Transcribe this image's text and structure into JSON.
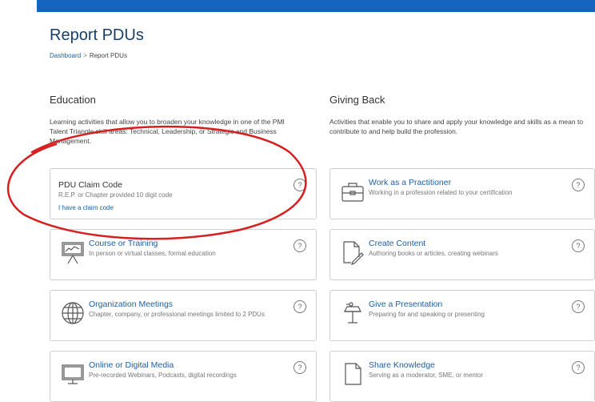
{
  "header": {
    "title": "Report PDUs"
  },
  "breadcrumb": {
    "home": "Dashboard",
    "sep": ">",
    "current": "Report PDUs"
  },
  "education": {
    "heading": "Education",
    "desc": "Learning activities that allow you to broaden your knowledge in one of the PMI Talent Triangle skill areas: Technical, Leadership, or Strategic and Business Management.",
    "claim": {
      "title": "PDU Claim Code",
      "desc": "R.E.P. or Chapter provided 10 digit code",
      "link": "I have a claim code",
      "help": "?"
    },
    "cards": [
      {
        "title": "Course or Training",
        "desc": "In person or virtual classes, formal education",
        "help": "?",
        "icon": "presentation-board-icon"
      },
      {
        "title": "Organization Meetings",
        "desc": "Chapter, company, or professional meetings limited to 2 PDUs",
        "help": "?",
        "icon": "globe-icon"
      },
      {
        "title": "Online or Digital Media",
        "desc": "Pre-recorded Webinars, Podcasts, digital recordings",
        "help": "?",
        "icon": "monitor-icon"
      }
    ]
  },
  "giving_back": {
    "heading": "Giving Back",
    "desc": "Activities that enable you to share and apply your knowledge and skills as a mean to contribute to and help build the profession.",
    "cards": [
      {
        "title": "Work as a Practitioner",
        "desc": "Working in a profession related to your certification",
        "help": "?",
        "icon": "briefcase-icon"
      },
      {
        "title": "Create Content",
        "desc": "Authoring books or articles, creating webinars",
        "help": "?",
        "icon": "document-pen-icon"
      },
      {
        "title": "Give a Presentation",
        "desc": "Preparing for and speaking or presenting",
        "help": "?",
        "icon": "podium-icon"
      },
      {
        "title": "Share Knowledge",
        "desc": "Serving as a moderator, SME, or mentor",
        "help": "?",
        "icon": "document-icon"
      }
    ]
  },
  "colors": {
    "topbar": "#1565c0",
    "link": "#1f5fa0",
    "annotation": "#d62020"
  }
}
